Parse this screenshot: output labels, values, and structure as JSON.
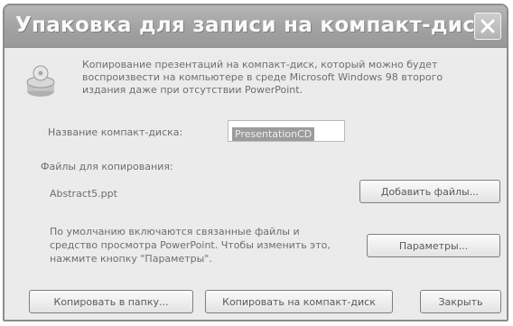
{
  "window": {
    "title": "Упаковка для записи на компакт-диск"
  },
  "content": {
    "description": "Копирование презентаций на компакт-диск, который можно будет воспроизвести на компьютере в среде Microsoft Windows 98 второго издания даже при отсутствии PowerPoint.",
    "cd_name_label": "Название компакт-диска:",
    "cd_name_value": "PresentationCD",
    "files_label": "Файлы для копирования:",
    "file_name": "Abstract5.ppt",
    "add_files_label": "Добавить файлы...",
    "note": "По умолчанию включаются связанные файлы и средство просмотра PowerPoint. Чтобы изменить это, нажмите кнопку \"Параметры\".",
    "options_label": "Параметры..."
  },
  "buttons": {
    "copy_to_folder": "Копировать в папку...",
    "copy_to_cd": "Копировать на компакт-диск",
    "close": "Закрыть"
  },
  "icons": {
    "cd": "cd-icon",
    "close": "close-icon"
  }
}
